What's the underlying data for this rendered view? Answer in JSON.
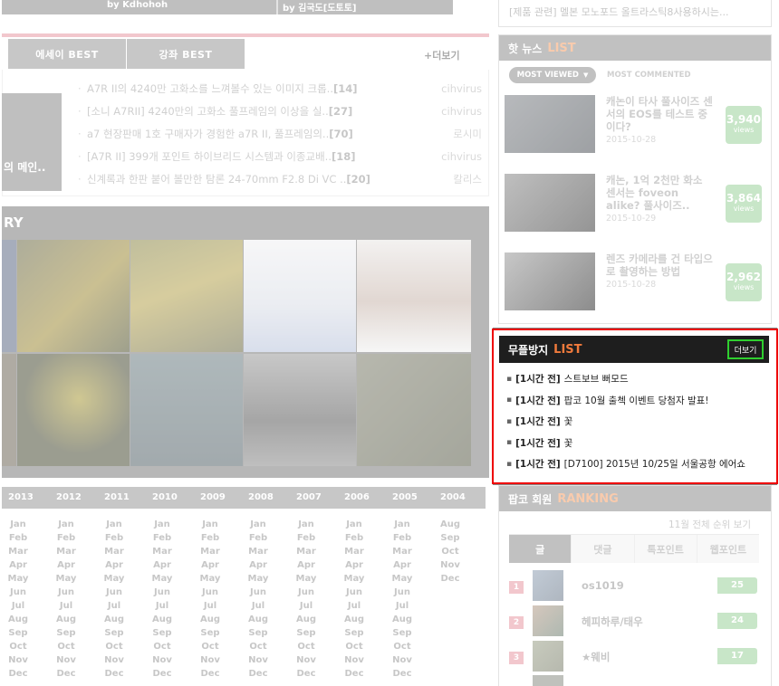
{
  "top_strip": {
    "item1": "by Kdhohoh",
    "item2": "by 김국도[도토토]"
  },
  "top_notice": "[제품 관련] 멜본 모노포드 올트라스틱8사용하시는...",
  "essay": {
    "tabs": [
      "에세이 BEST",
      "강좌 BEST"
    ],
    "more": "+더보기",
    "thumb_caption": "의 메인..",
    "items": [
      {
        "title": "A7R II의 4240만 고화소를 느껴볼수 있는 이미지 크롭..",
        "count": "[14]",
        "author": "cihvirus"
      },
      {
        "title": "[소니 A7RII] 4240만의 고화소 풀프레임의 이상을 실..",
        "count": "[27]",
        "author": "cihvirus"
      },
      {
        "title": "a7 현장판매 1호 구매자가 경험한 a7R II, 풀프레임의..",
        "count": "[70]",
        "author": "로시미"
      },
      {
        "title": "[A7R II] 399개 포인트 하이브리드 시스템과 이종교배..",
        "count": "[18]",
        "author": "cihvirus"
      },
      {
        "title": "신계록과 한판 붙어 볼만한 탐론 24-70mm F2.8 Di VC ..",
        "count": "[20]",
        "author": "칼리스"
      }
    ]
  },
  "gallery": {
    "title": "RY"
  },
  "archive": {
    "years": [
      "2013",
      "2012",
      "2011",
      "2010",
      "2009",
      "2008",
      "2007",
      "2006",
      "2005",
      "2004"
    ],
    "months_full": [
      "Jan",
      "Feb",
      "Mar",
      "Apr",
      "May",
      "Jun",
      "Jul",
      "Aug",
      "Sep",
      "Oct",
      "Nov",
      "Dec"
    ],
    "months_2004": [
      "Aug",
      "Sep",
      "Oct",
      "Nov",
      "Dec"
    ]
  },
  "hot_news": {
    "title": "핫 뉴스",
    "accent": "LIST",
    "tab_active": "MOST VIEWED",
    "tab_other": "MOST COMMENTED",
    "items": [
      {
        "title": "캐논이 타사 풀사이즈 센서의 EOS를 테스트 중이다?",
        "date": "2015-10-28",
        "views": "3,940",
        "unit": "views"
      },
      {
        "title": "캐논, 1억 2천만 화소 센서는 foveon alike? 풀사이즈..",
        "date": "2015-10-29",
        "views": "3,864",
        "unit": "views"
      },
      {
        "title": "렌즈 카메라를 건 타입으로 촬영하는 방법",
        "date": "2015-10-28",
        "views": "2,962",
        "unit": "views"
      }
    ]
  },
  "anti_spam": {
    "title": "무플방지",
    "accent": "LIST",
    "more": "더보기",
    "items": [
      {
        "tag": "[1시간 전]",
        "text": "스트보브 뻐모드"
      },
      {
        "tag": "[1시간 전]",
        "text": "팝코 10월 출첵 이벤트 당첨자 발표!"
      },
      {
        "tag": "[1시간 전]",
        "text": "꽃"
      },
      {
        "tag": "[1시간 전]",
        "text": "꽃"
      },
      {
        "tag": "[1시간 전]",
        "text": "[D7100] 2015년 10/25일 서울공항 에어쇼"
      }
    ]
  },
  "ranking": {
    "title": "팝코 회원",
    "accent": "RANKING",
    "sub": "11월 전체 순위 보기",
    "tabs": [
      "글",
      "댓글",
      "톡포인트",
      "웹포인트"
    ],
    "rows": [
      {
        "rank": "1",
        "name": "os1019",
        "score": "25"
      },
      {
        "rank": "2",
        "name": "헤피하루/태우",
        "score": "24"
      },
      {
        "rank": "3",
        "name": "★웨비",
        "score": "17"
      }
    ]
  },
  "colors": {
    "highlight_border": "#ee0000",
    "more_button_border": "#2fcf2f",
    "accent_orange": "#f07a3c",
    "views_green": "#9cd19c",
    "rank_pink": "#e79aa5"
  }
}
